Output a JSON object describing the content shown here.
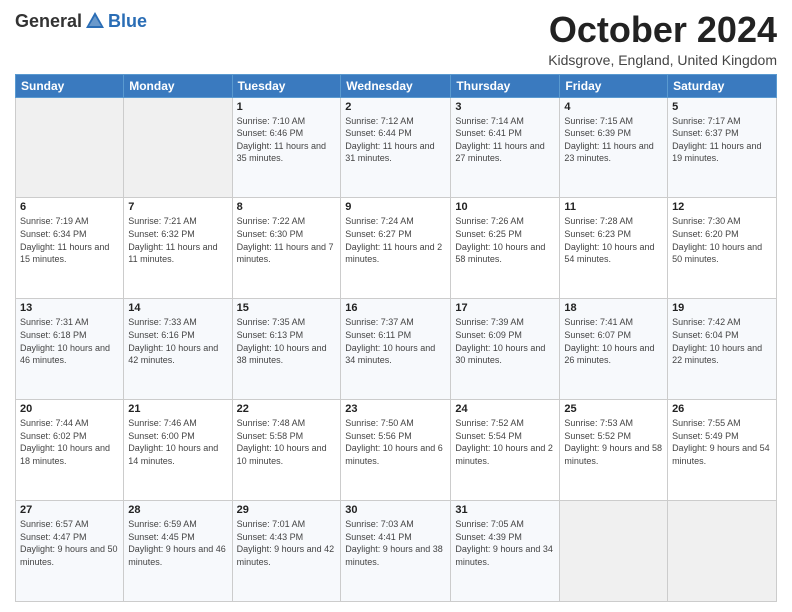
{
  "logo": {
    "general": "General",
    "blue": "Blue"
  },
  "title": "October 2024",
  "location": "Kidsgrove, England, United Kingdom",
  "days_header": [
    "Sunday",
    "Monday",
    "Tuesday",
    "Wednesday",
    "Thursday",
    "Friday",
    "Saturday"
  ],
  "weeks": [
    [
      {
        "day": "",
        "sunrise": "",
        "sunset": "",
        "daylight": ""
      },
      {
        "day": "",
        "sunrise": "",
        "sunset": "",
        "daylight": ""
      },
      {
        "day": "1",
        "sunrise": "Sunrise: 7:10 AM",
        "sunset": "Sunset: 6:46 PM",
        "daylight": "Daylight: 11 hours and 35 minutes."
      },
      {
        "day": "2",
        "sunrise": "Sunrise: 7:12 AM",
        "sunset": "Sunset: 6:44 PM",
        "daylight": "Daylight: 11 hours and 31 minutes."
      },
      {
        "day": "3",
        "sunrise": "Sunrise: 7:14 AM",
        "sunset": "Sunset: 6:41 PM",
        "daylight": "Daylight: 11 hours and 27 minutes."
      },
      {
        "day": "4",
        "sunrise": "Sunrise: 7:15 AM",
        "sunset": "Sunset: 6:39 PM",
        "daylight": "Daylight: 11 hours and 23 minutes."
      },
      {
        "day": "5",
        "sunrise": "Sunrise: 7:17 AM",
        "sunset": "Sunset: 6:37 PM",
        "daylight": "Daylight: 11 hours and 19 minutes."
      }
    ],
    [
      {
        "day": "6",
        "sunrise": "Sunrise: 7:19 AM",
        "sunset": "Sunset: 6:34 PM",
        "daylight": "Daylight: 11 hours and 15 minutes."
      },
      {
        "day": "7",
        "sunrise": "Sunrise: 7:21 AM",
        "sunset": "Sunset: 6:32 PM",
        "daylight": "Daylight: 11 hours and 11 minutes."
      },
      {
        "day": "8",
        "sunrise": "Sunrise: 7:22 AM",
        "sunset": "Sunset: 6:30 PM",
        "daylight": "Daylight: 11 hours and 7 minutes."
      },
      {
        "day": "9",
        "sunrise": "Sunrise: 7:24 AM",
        "sunset": "Sunset: 6:27 PM",
        "daylight": "Daylight: 11 hours and 2 minutes."
      },
      {
        "day": "10",
        "sunrise": "Sunrise: 7:26 AM",
        "sunset": "Sunset: 6:25 PM",
        "daylight": "Daylight: 10 hours and 58 minutes."
      },
      {
        "day": "11",
        "sunrise": "Sunrise: 7:28 AM",
        "sunset": "Sunset: 6:23 PM",
        "daylight": "Daylight: 10 hours and 54 minutes."
      },
      {
        "day": "12",
        "sunrise": "Sunrise: 7:30 AM",
        "sunset": "Sunset: 6:20 PM",
        "daylight": "Daylight: 10 hours and 50 minutes."
      }
    ],
    [
      {
        "day": "13",
        "sunrise": "Sunrise: 7:31 AM",
        "sunset": "Sunset: 6:18 PM",
        "daylight": "Daylight: 10 hours and 46 minutes."
      },
      {
        "day": "14",
        "sunrise": "Sunrise: 7:33 AM",
        "sunset": "Sunset: 6:16 PM",
        "daylight": "Daylight: 10 hours and 42 minutes."
      },
      {
        "day": "15",
        "sunrise": "Sunrise: 7:35 AM",
        "sunset": "Sunset: 6:13 PM",
        "daylight": "Daylight: 10 hours and 38 minutes."
      },
      {
        "day": "16",
        "sunrise": "Sunrise: 7:37 AM",
        "sunset": "Sunset: 6:11 PM",
        "daylight": "Daylight: 10 hours and 34 minutes."
      },
      {
        "day": "17",
        "sunrise": "Sunrise: 7:39 AM",
        "sunset": "Sunset: 6:09 PM",
        "daylight": "Daylight: 10 hours and 30 minutes."
      },
      {
        "day": "18",
        "sunrise": "Sunrise: 7:41 AM",
        "sunset": "Sunset: 6:07 PM",
        "daylight": "Daylight: 10 hours and 26 minutes."
      },
      {
        "day": "19",
        "sunrise": "Sunrise: 7:42 AM",
        "sunset": "Sunset: 6:04 PM",
        "daylight": "Daylight: 10 hours and 22 minutes."
      }
    ],
    [
      {
        "day": "20",
        "sunrise": "Sunrise: 7:44 AM",
        "sunset": "Sunset: 6:02 PM",
        "daylight": "Daylight: 10 hours and 18 minutes."
      },
      {
        "day": "21",
        "sunrise": "Sunrise: 7:46 AM",
        "sunset": "Sunset: 6:00 PM",
        "daylight": "Daylight: 10 hours and 14 minutes."
      },
      {
        "day": "22",
        "sunrise": "Sunrise: 7:48 AM",
        "sunset": "Sunset: 5:58 PM",
        "daylight": "Daylight: 10 hours and 10 minutes."
      },
      {
        "day": "23",
        "sunrise": "Sunrise: 7:50 AM",
        "sunset": "Sunset: 5:56 PM",
        "daylight": "Daylight: 10 hours and 6 minutes."
      },
      {
        "day": "24",
        "sunrise": "Sunrise: 7:52 AM",
        "sunset": "Sunset: 5:54 PM",
        "daylight": "Daylight: 10 hours and 2 minutes."
      },
      {
        "day": "25",
        "sunrise": "Sunrise: 7:53 AM",
        "sunset": "Sunset: 5:52 PM",
        "daylight": "Daylight: 9 hours and 58 minutes."
      },
      {
        "day": "26",
        "sunrise": "Sunrise: 7:55 AM",
        "sunset": "Sunset: 5:49 PM",
        "daylight": "Daylight: 9 hours and 54 minutes."
      }
    ],
    [
      {
        "day": "27",
        "sunrise": "Sunrise: 6:57 AM",
        "sunset": "Sunset: 4:47 PM",
        "daylight": "Daylight: 9 hours and 50 minutes."
      },
      {
        "day": "28",
        "sunrise": "Sunrise: 6:59 AM",
        "sunset": "Sunset: 4:45 PM",
        "daylight": "Daylight: 9 hours and 46 minutes."
      },
      {
        "day": "29",
        "sunrise": "Sunrise: 7:01 AM",
        "sunset": "Sunset: 4:43 PM",
        "daylight": "Daylight: 9 hours and 42 minutes."
      },
      {
        "day": "30",
        "sunrise": "Sunrise: 7:03 AM",
        "sunset": "Sunset: 4:41 PM",
        "daylight": "Daylight: 9 hours and 38 minutes."
      },
      {
        "day": "31",
        "sunrise": "Sunrise: 7:05 AM",
        "sunset": "Sunset: 4:39 PM",
        "daylight": "Daylight: 9 hours and 34 minutes."
      },
      {
        "day": "",
        "sunrise": "",
        "sunset": "",
        "daylight": ""
      },
      {
        "day": "",
        "sunrise": "",
        "sunset": "",
        "daylight": ""
      }
    ]
  ]
}
